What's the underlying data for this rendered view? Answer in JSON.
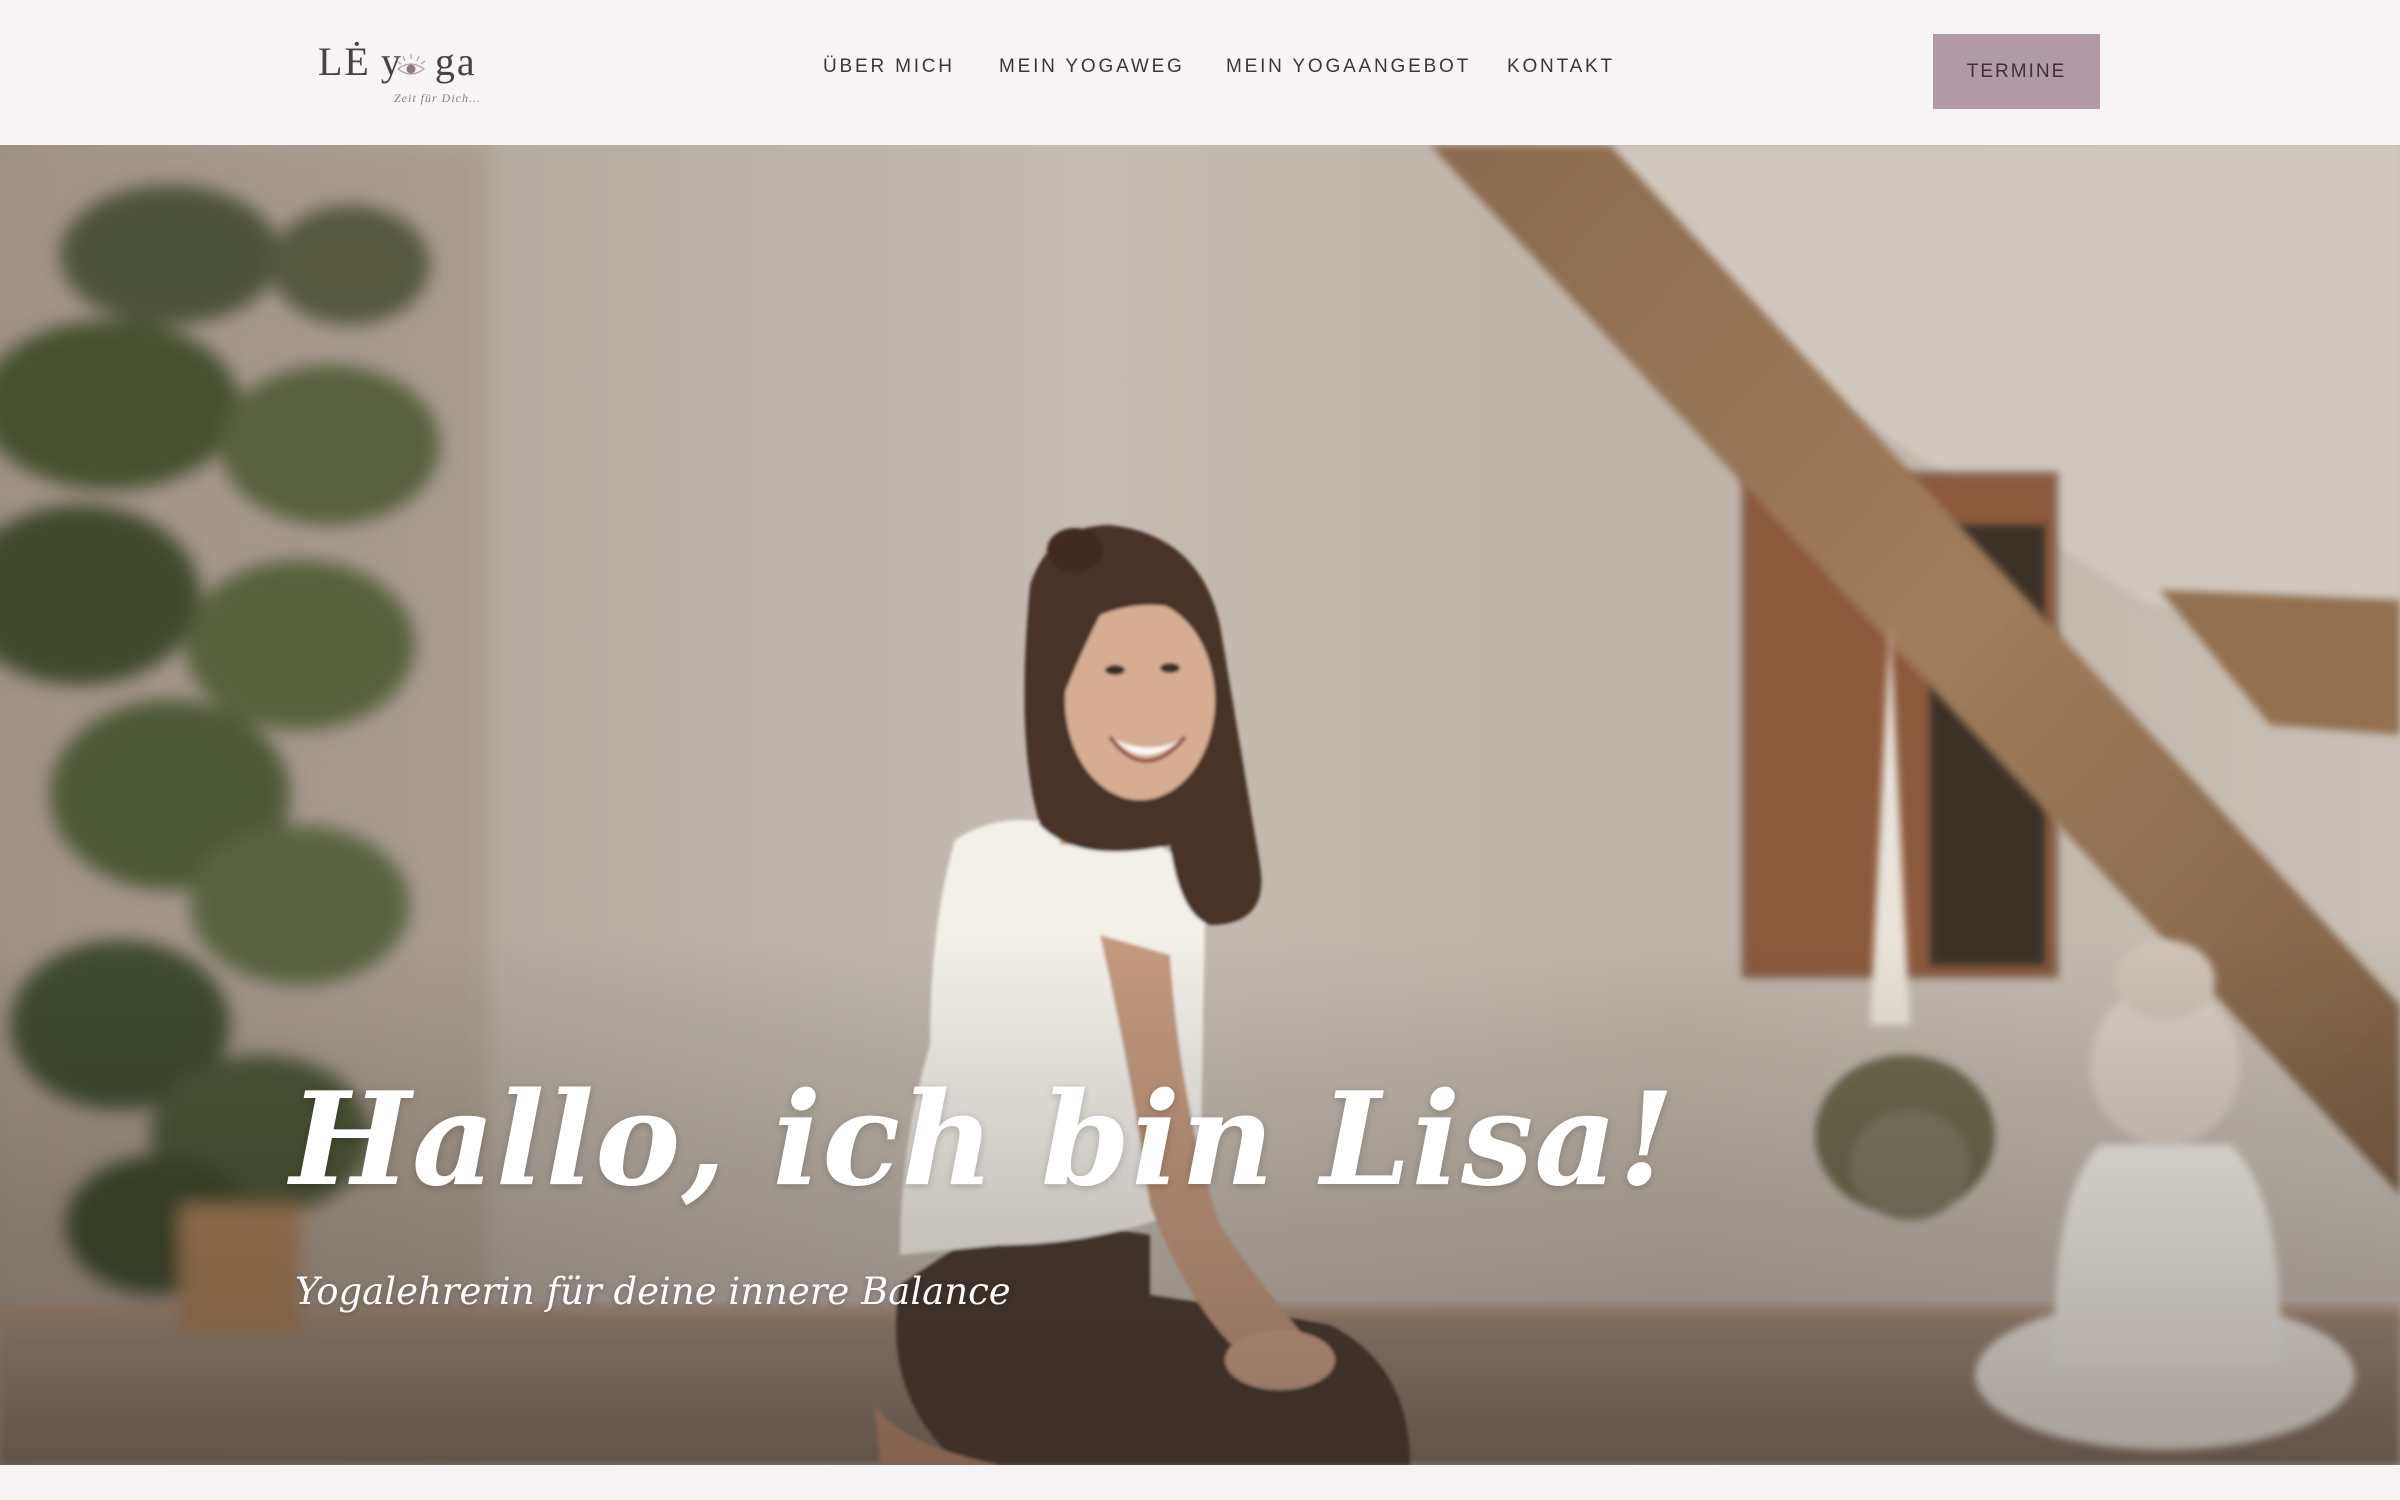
{
  "brand": {
    "logo_text_left": "LĖ",
    "logo_text_y": "y",
    "logo_text_right": "ga",
    "tagline": "Zeit für Dich..."
  },
  "nav": {
    "items": [
      {
        "label": "ÜBER MICH"
      },
      {
        "label": "MEIN YOGAWEG"
      },
      {
        "label": "MEIN YOGAANGEBOT"
      },
      {
        "label": "KONTAKT"
      }
    ],
    "cta_label": "TERMINE"
  },
  "hero": {
    "title": "Hallo, ich bin Lisa!",
    "subtitle": "Yogalehrerin für deine innere Balance"
  },
  "colors": {
    "accent": "#b19aa6",
    "header_bg": "#f6f4f4",
    "text_dark": "#3c3736"
  },
  "icons": {
    "logo_eye": "eye-icon"
  }
}
